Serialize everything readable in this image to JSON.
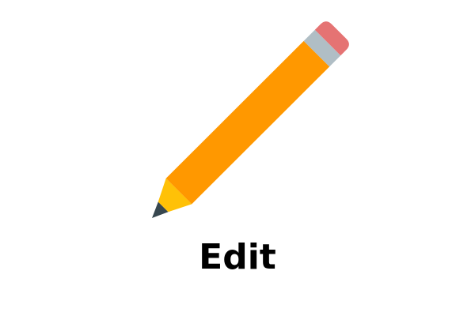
{
  "label": "Edit",
  "icon": "pencil-icon",
  "colors": {
    "background": "#ffffff",
    "text": "#000000",
    "pencil_body": "#ff9800",
    "eraser": "#e57373",
    "ferrule": "#b0bec5",
    "wood_tip": "#ffc107",
    "graphite": "#37474f"
  }
}
